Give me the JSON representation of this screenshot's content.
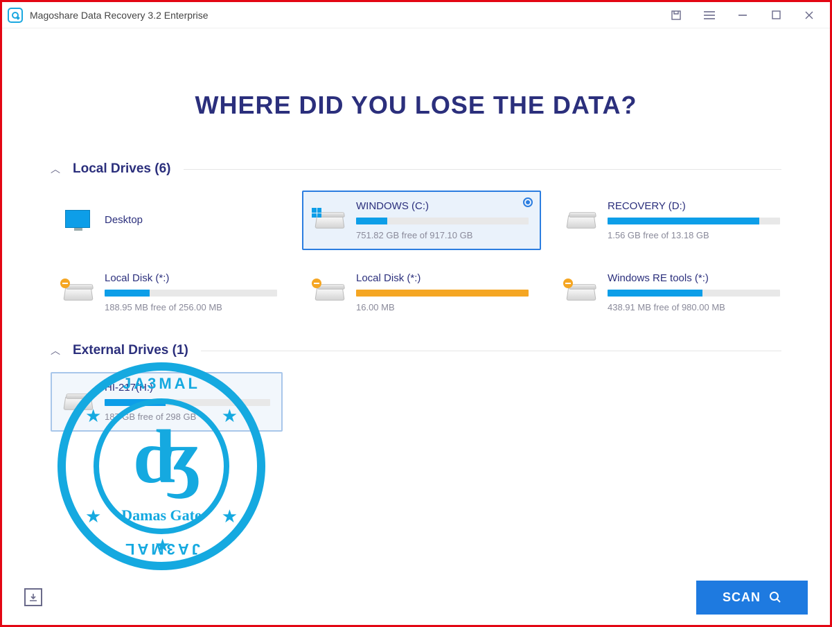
{
  "app": {
    "title": "Magoshare Data Recovery 3.2 Enterprise"
  },
  "headline": "WHERE DID YOU LOSE THE DATA?",
  "sections": {
    "local": {
      "title": "Local Drives (6)"
    },
    "external": {
      "title": "External Drives (1)"
    }
  },
  "drives": {
    "desktop": {
      "name": "Desktop"
    },
    "c": {
      "name": "WINDOWS (C:)",
      "stat": "751.82 GB free of 917.10 GB",
      "used_pct": 18
    },
    "d": {
      "name": "RECOVERY (D:)",
      "stat": "1.56 GB free of 13.18 GB",
      "used_pct": 88
    },
    "l1": {
      "name": "Local Disk (*:)",
      "stat": "188.95 MB free of 256.00 MB",
      "used_pct": 26
    },
    "l2": {
      "name": "Local Disk (*:)",
      "stat": "16.00 MB",
      "used_pct": 100
    },
    "re": {
      "name": "Windows RE tools (*:)",
      "stat": "438.91 MB free of 980.00 MB",
      "used_pct": 55
    },
    "ext": {
      "name": "HI-217(H:)",
      "stat": "187 GB free of 298 GB",
      "used_pct": 37
    }
  },
  "footer": {
    "scan": "SCAN"
  },
  "stamp": {
    "top": "JA3MAL",
    "name": "Damas Gate",
    "bottom": "JA3MAL"
  }
}
